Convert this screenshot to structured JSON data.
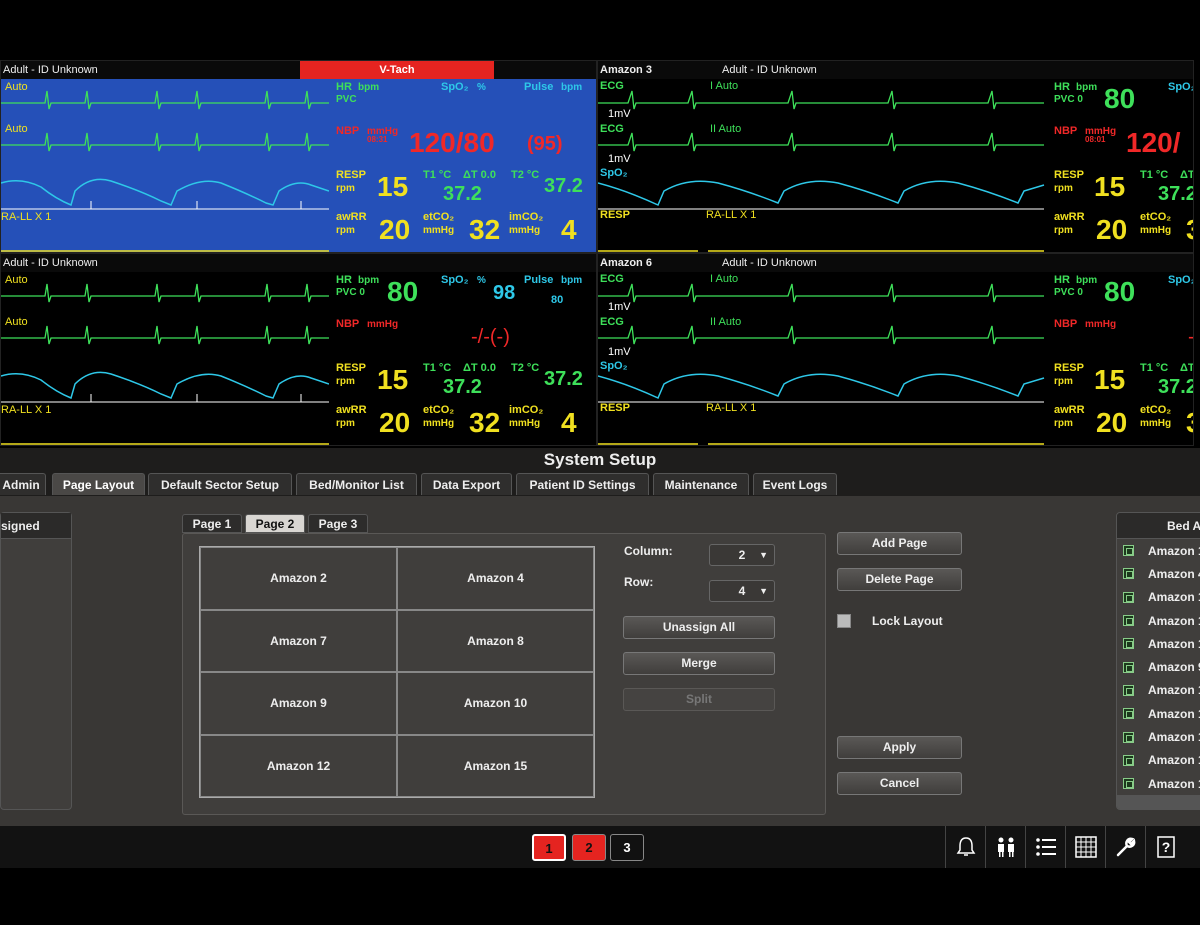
{
  "monitor": {
    "tl": {
      "name": "",
      "pid": "Adult - ID Unknown",
      "alarm": "V-Tach",
      "lead1": "Auto",
      "lead2": "Auto",
      "lead3": "RA-LL X 1",
      "hr_label": "HR",
      "hr_unit": "bpm",
      "pvc": "PVC",
      "spo2_label": "SpO₂",
      "spo2_unit": "%",
      "pulse_label": "Pulse",
      "pulse_unit": "bpm",
      "nbp_label": "NBP",
      "nbp_unit": "mmHg",
      "nbp_time": "08:31",
      "nbp_value": "120/80",
      "nbp_mean": "(95)",
      "resp_label": "RESP",
      "resp_unit": "rpm",
      "resp_value": "15",
      "t1": "T1 °C",
      "dt": "ΔT 0.0",
      "t2": "T2 °C",
      "t1_value": "37.2",
      "t2_value": "37.2",
      "awrr_label": "awRR",
      "awrr_unit": "rpm",
      "awrr_value": "20",
      "etco2_label": "etCO₂",
      "etco2_unit": "mmHg",
      "etco2_value": "32",
      "imco2_label": "imCO₂",
      "imco2_unit": "mmHg",
      "imco2_value": "4"
    },
    "tr": {
      "name": "Amazon 3",
      "pid": "Adult - ID Unknown",
      "ecg1": "ECG",
      "lead1": "I  Auto",
      "mv1": "1mV",
      "ecg2": "ECG",
      "lead2": "II  Auto",
      "mv2": "1mV",
      "spo2w": "SpO₂",
      "respw": "RESP",
      "rall": "RA-LL X 1",
      "hr_label": "HR",
      "hr_unit": "bpm",
      "pvc": "PVC  0",
      "hr_value": "80",
      "spo2_label": "SpO₂",
      "nbp_label": "NBP",
      "nbp_unit": "mmHg",
      "nbp_time": "08:01",
      "nbp_value": "120/",
      "resp_label": "RESP",
      "resp_unit": "rpm",
      "resp_value": "15",
      "t1": "T1 °C",
      "dt": "ΔT",
      "t1_value": "37.2",
      "awrr_label": "awRR",
      "awrr_unit": "rpm",
      "awrr_value": "20",
      "etco2_label": "etCO₂",
      "etco2_unit": "mmHg",
      "etco2_value": "3"
    },
    "bl": {
      "pid": "Adult - ID Unknown",
      "lead1": "Auto",
      "lead2": "Auto",
      "lead3": "RA-LL X 1",
      "hr_label": "HR",
      "hr_unit": "bpm",
      "pvc": "PVC  0",
      "hr_value": "80",
      "spo2_label": "SpO₂",
      "spo2_unit": "%",
      "spo2_value": "98",
      "pulse_label": "Pulse",
      "pulse_unit": "bpm",
      "pulse_value": "80",
      "nbp_label": "NBP",
      "nbp_unit": "mmHg",
      "nbp_value": "-/-(-)",
      "resp_label": "RESP",
      "resp_unit": "rpm",
      "resp_value": "15",
      "t1": "T1 °C",
      "dt": "ΔT 0.0",
      "t2": "T2 °C",
      "t1_value": "37.2",
      "t2_value": "37.2",
      "awrr_label": "awRR",
      "awrr_unit": "rpm",
      "awrr_value": "20",
      "etco2_label": "etCO₂",
      "etco2_unit": "mmHg",
      "etco2_value": "32",
      "imco2_label": "imCO₂",
      "imco2_unit": "mmHg",
      "imco2_value": "4"
    },
    "br": {
      "name": "Amazon 6",
      "pid": "Adult - ID Unknown",
      "ecg1": "ECG",
      "lead1": "I  Auto",
      "mv1": "1mV",
      "ecg2": "ECG",
      "lead2": "II  Auto",
      "mv2": "1mV",
      "spo2w": "SpO₂",
      "respw": "RESP",
      "rall": "RA-LL X 1",
      "hr_label": "HR",
      "hr_unit": "bpm",
      "pvc": "PVC  0",
      "hr_value": "80",
      "spo2_label": "SpO₂",
      "nbp_label": "NBP",
      "nbp_unit": "mmHg",
      "nbp_value": "-/",
      "resp_label": "RESP",
      "resp_unit": "rpm",
      "resp_value": "15",
      "t1": "T1 °C",
      "dt": "ΔT",
      "t1_value": "37.2",
      "awrr_label": "awRR",
      "awrr_unit": "rpm",
      "awrr_value": "20",
      "etco2_label": "etCO₂",
      "etco2_unit": "mmHg",
      "etco2_value": "3"
    }
  },
  "setup": {
    "title": "System Setup",
    "tabs": [
      "Admin",
      "Page Layout",
      "Default Sector Setup",
      "Bed/Monitor List",
      "Data Export",
      "Patient ID Settings",
      "Maintenance",
      "Event Logs"
    ],
    "unassigned_header": "signed",
    "page_tabs": [
      "Page 1",
      "Page 2",
      "Page 3"
    ],
    "grid": [
      "Amazon 2",
      "Amazon 4",
      "Amazon 7",
      "Amazon 8",
      "Amazon 9",
      "Amazon 10",
      "Amazon 12",
      "Amazon 15"
    ],
    "column_label": "Column:",
    "column_value": "2",
    "row_label": "Row:",
    "row_value": "4",
    "unassign_all": "Unassign All",
    "merge": "Merge",
    "split": "Split",
    "add_page": "Add Page",
    "delete_page": "Delete Page",
    "lock_layout": "Lock Layout",
    "apply": "Apply",
    "cancel": "Cancel",
    "bed_header": "Bed A",
    "beds": [
      "Amazon 1",
      "Amazon 4",
      "Amazon 1",
      "Amazon 1",
      "Amazon 1",
      "Amazon 9",
      "Amazon 1",
      "Amazon 1",
      "Amazon 1",
      "Amazon 1",
      "Amazon 1"
    ]
  },
  "footer": {
    "pages": [
      "1",
      "2",
      "3"
    ],
    "icons": [
      "bell-icon",
      "people-icon",
      "list-icon",
      "grid-icon",
      "wrench-icon",
      "help-icon"
    ]
  },
  "colors": {
    "alarm": "#e52420",
    "param_green": "#3ee05a",
    "param_yellow": "#f0e020",
    "param_cyan": "#2ec8e8",
    "param_red": "#f02828",
    "alarm_bg": "#2550b8"
  }
}
